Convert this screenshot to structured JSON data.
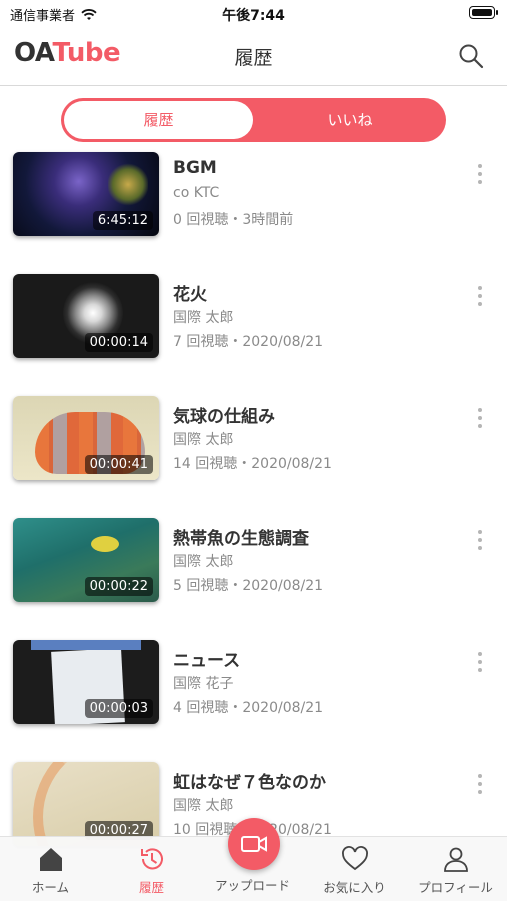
{
  "status_bar": {
    "carrier": "通信事業者",
    "time": "午後7:44"
  },
  "nav": {
    "logo_main": "OA",
    "logo_accent": "Tube",
    "title": "履歴"
  },
  "segment": {
    "left_label": "履歴",
    "right_label": "いいね",
    "selected": "履歴"
  },
  "videos": [
    {
      "title": "BGM",
      "channel": "co KTC",
      "meta": "0 回視聴・3時間前",
      "duration": "6:45:12"
    },
    {
      "title": "花火",
      "channel": "国際 太郎",
      "meta": "7 回視聴・2020/08/21",
      "duration": "00:00:14"
    },
    {
      "title": "気球の仕組み",
      "channel": "国際 太郎",
      "meta": "14 回視聴・2020/08/21",
      "duration": "00:00:41"
    },
    {
      "title": "熱帯魚の生態調査",
      "channel": "国際 太郎",
      "meta": "5 回視聴・2020/08/21",
      "duration": "00:00:22"
    },
    {
      "title": "ニュース",
      "channel": "国際 花子",
      "meta": "4 回視聴・2020/08/21",
      "duration": "00:00:03"
    },
    {
      "title": "虹はなぜ７色なのか",
      "channel": "国際 太郎",
      "meta": "10 回視聴・2020/08/21",
      "duration": "00:00:27"
    }
  ],
  "tabbar": {
    "home": "ホーム",
    "history": "履歴",
    "upload": "アップロード",
    "favorites": "お気に入り",
    "profile": "プロフィール",
    "active": "履歴"
  },
  "colors": {
    "accent": "#f35b66",
    "text": "#333333",
    "subtext": "#8a8a8a"
  }
}
